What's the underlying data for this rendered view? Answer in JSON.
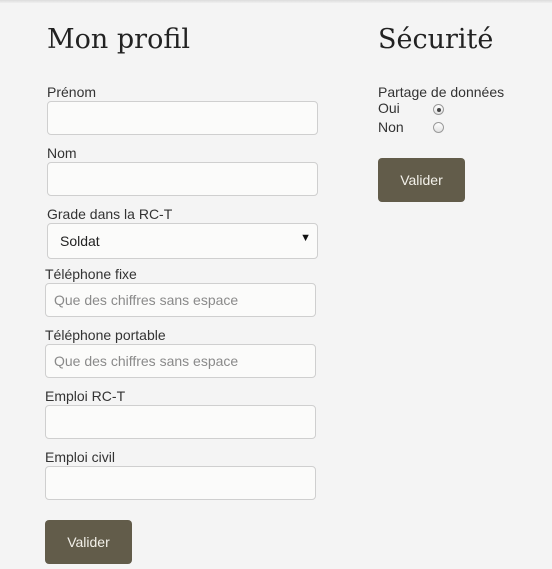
{
  "profile": {
    "title": "Mon profil",
    "prenom": {
      "label": "Prénom",
      "value": "",
      "placeholder": ""
    },
    "nom": {
      "label": "Nom",
      "value": "",
      "placeholder": ""
    },
    "grade": {
      "label": "Grade dans la RC-T",
      "selected": "Soldat"
    },
    "tel_fixe": {
      "label": "Téléphone fixe",
      "value": "",
      "placeholder": "Que des chiffres sans espace"
    },
    "tel_portable": {
      "label": "Téléphone portable",
      "value": "",
      "placeholder": "Que des chiffres sans espace"
    },
    "emploi_rct": {
      "label": "Emploi RC-T",
      "value": "",
      "placeholder": ""
    },
    "emploi_civil": {
      "label": "Emploi civil",
      "value": "",
      "placeholder": ""
    },
    "submit_label": "Valider"
  },
  "security": {
    "title": "Sécurité",
    "data_sharing": {
      "label": "Partage de données",
      "options": [
        {
          "label": "Oui",
          "checked": true
        },
        {
          "label": "Non",
          "checked": false
        }
      ]
    },
    "submit_label": "Valider"
  },
  "colors": {
    "button_bg": "#625c4a",
    "page_bg": "#f4f4f4"
  },
  "icons": {
    "select_caret": "caret-down-icon"
  }
}
